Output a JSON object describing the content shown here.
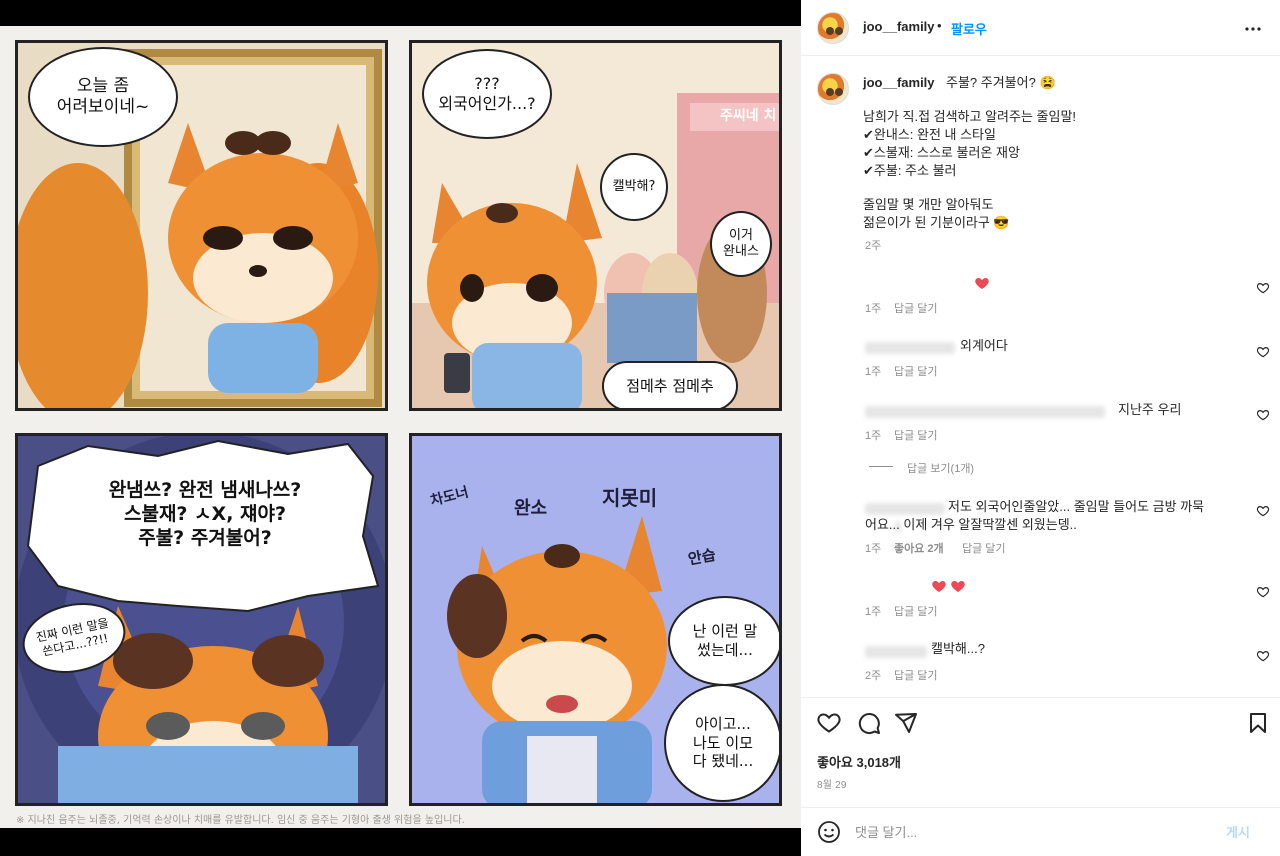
{
  "media": {
    "panel1": {
      "bubble": "오늘 좀\n어려보이네~"
    },
    "panel2": {
      "thought": "???\n외국어인가...?",
      "sign": "주씨네 치",
      "bubble_a": "캘박해?",
      "bubble_b": "이거\n완내스",
      "bubble_c": "점메추 점메추"
    },
    "panel3": {
      "burst": "완냄쓰? 완전 냄새나쓰?\n스불재? ㅅX, 쟤야?\n주불? 주겨불어?",
      "side": "진짜 이런 말을\n쓴다고...??!!"
    },
    "panel4": {
      "sfx1": "차도너",
      "sfx2": "완소",
      "sfx3": "지못미",
      "sfx4": "안습",
      "bubble_a": "난 이런 말\n썼는데...",
      "bubble_b": "아이고...\n나도 이모\n다 됐네..."
    },
    "disclaimer": "※ 지나친 음주는 뇌졸중, 기억력 손상이나 치매를 유발합니다. 임신 중 음주는 기형아 출생 위험을 높입니다."
  },
  "header": {
    "username": "joo__family",
    "separator": "•",
    "follow_label": "팔로우"
  },
  "caption": {
    "username": "joo__family",
    "first_line": "주불? 주겨불어? 😫",
    "lines": [
      "남희가 직.접 검색하고 알려주는 줄임말!",
      "✔완내스: 완전 내 스타일",
      "✔스불재: 스스로 불러온 재앙",
      "✔주불: 주소 불러",
      "",
      "줄임말 몇 개만 알아둬도",
      "젊은이가 된 기분이라구 😎"
    ],
    "age": "2주"
  },
  "comments": [
    {
      "text": "",
      "has_heart_emoji": true,
      "age": "1주",
      "reply_label": "답글 달기"
    },
    {
      "text": "외계어다",
      "age": "1주",
      "reply_label": "답글 달기"
    },
    {
      "text": "지난주 우리",
      "age": "1주",
      "reply_label": "답글 달기",
      "view_replies": "답글 보기(1개)"
    },
    {
      "text_line1": "저도 외국어인줄알았... 줄임말 들어도 금방 까묵",
      "text_line2": "어요... 이제 겨우 알잘딱깔센 외웠는뎅..",
      "age": "1주",
      "likes": "좋아요 2개",
      "reply_label": "답글 달기"
    },
    {
      "text": "",
      "has_double_heart": true,
      "age": "1주",
      "reply_label": "답글 달기"
    },
    {
      "text": "캘박해...?",
      "age": "2주",
      "reply_label": "답글 달기"
    }
  ],
  "stats": {
    "likes": "좋아요 3,018개",
    "date": "8월 29"
  },
  "composer": {
    "placeholder": "댓글 달기...",
    "post_label": "게시"
  },
  "colors": {
    "link_blue": "#0095f6",
    "heart_red": "#ed4956",
    "muted": "#8e8e8e"
  }
}
